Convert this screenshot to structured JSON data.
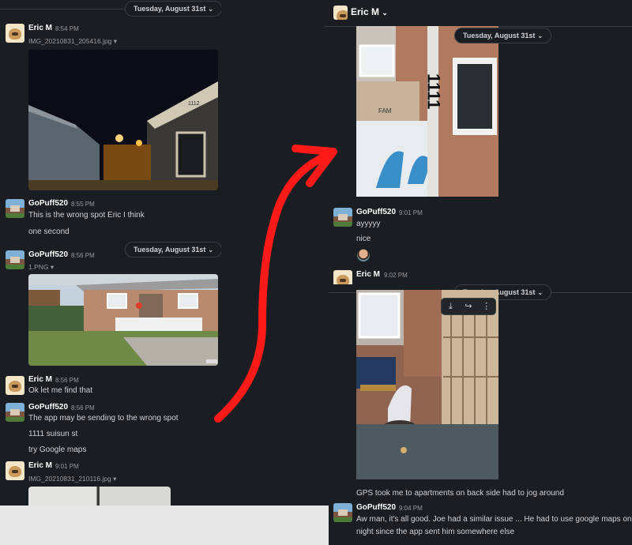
{
  "date_divider": {
    "label": "Tuesday, August 31st"
  },
  "left_feed": {
    "messages": [
      {
        "author": "Eric M",
        "time": "8:54 PM",
        "file": "IMG_20210831_205416.jpg"
      },
      {
        "author": "GoPuff520",
        "time": "8:55 PM",
        "lines": [
          "This is the wrong spot Eric I think",
          "one second"
        ]
      },
      {
        "author": "GoPuff520",
        "time": "8:56 PM",
        "file": "1.PNG"
      },
      {
        "author": "Eric M",
        "time": "8:56 PM",
        "lines": [
          "Ok let me find that"
        ]
      },
      {
        "author": "GoPuff520",
        "time": "8:56 PM",
        "lines": [
          "The app may be sending to the wrong spot",
          "1111 suisun st",
          "try Google maps"
        ]
      },
      {
        "author": "Eric M",
        "time": "9:01 PM",
        "file": "IMG_20210831_210116.jpg"
      }
    ]
  },
  "right_feed": {
    "header": {
      "title": "Eric M"
    },
    "messages": [
      {
        "author": "GoPuff520",
        "time": "9:01 PM",
        "lines": [
          "ayyyyy",
          "nice"
        ]
      },
      {
        "author": "Eric M",
        "time": "9:02 PM"
      },
      {
        "lines": [
          "GPS took me to apartments on back side had to jog around"
        ]
      },
      {
        "author": "GoPuff520",
        "time": "9:04 PM",
        "lines": [
          "Aw man, it's all good. Joe had a similar issue ... He had to use google maps on Sa",
          "night since the app sent him somewhere else"
        ]
      }
    ]
  },
  "photo_text": {
    "garage_number": "1112",
    "box_label": "FAM",
    "door_number": "1111"
  },
  "icons": {
    "chevron": "chevron-down-icon",
    "download": "download-icon",
    "share": "share-icon",
    "more": "more-icon"
  },
  "colors": {
    "background": "#1a1d21",
    "arrow": "#ff1a1a",
    "text": "#d1d2d3"
  }
}
